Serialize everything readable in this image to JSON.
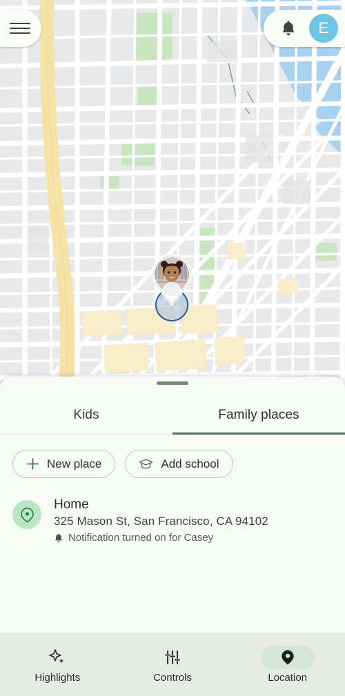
{
  "app": {
    "accent_green": "#45795f",
    "sheet_bg": "#f8faf5",
    "navbar_bg": "#e7ebe6",
    "avatar_bg": "#6ec6e6",
    "place_icon_bg": "#b9e7c4",
    "active_pill_bg": "#d3e6d7"
  },
  "map": {
    "name": "location-map",
    "water_color": "#a9d1f0",
    "park_color": "#c8e6c0",
    "block_color": "#e8e9ea",
    "highway_color": "#f2e0a0",
    "road_color": "#ffffff",
    "child_marker_label": "child-location-marker",
    "accuracy_circle_label": "location-accuracy-circle"
  },
  "topbar": {
    "menu_icon": "hamburger-menu-icon",
    "bell_icon": "notification-bell-icon",
    "avatar_initial": "E"
  },
  "sheet": {
    "drag_handle": "sheet-drag-handle",
    "tabs": [
      {
        "label": "Kids",
        "active": false
      },
      {
        "label": "Family places",
        "active": true
      }
    ],
    "chips": [
      {
        "label": "New place",
        "icon": "plus-icon"
      },
      {
        "label": "Add school",
        "icon": "graduation-cap-icon"
      }
    ],
    "places": [
      {
        "icon": "location-pin-icon",
        "title": "Home",
        "address": "325 Mason St, San Francisco, CA 94102",
        "note_icon": "bell-icon",
        "note": "Notification turned on for Casey"
      }
    ]
  },
  "bottom_nav": [
    {
      "label": "Highlights",
      "icon": "sparkle-icon",
      "active": false
    },
    {
      "label": "Controls",
      "icon": "tune-sliders-icon",
      "active": false
    },
    {
      "label": "Location",
      "icon": "location-pin-filled-icon",
      "active": true
    }
  ]
}
